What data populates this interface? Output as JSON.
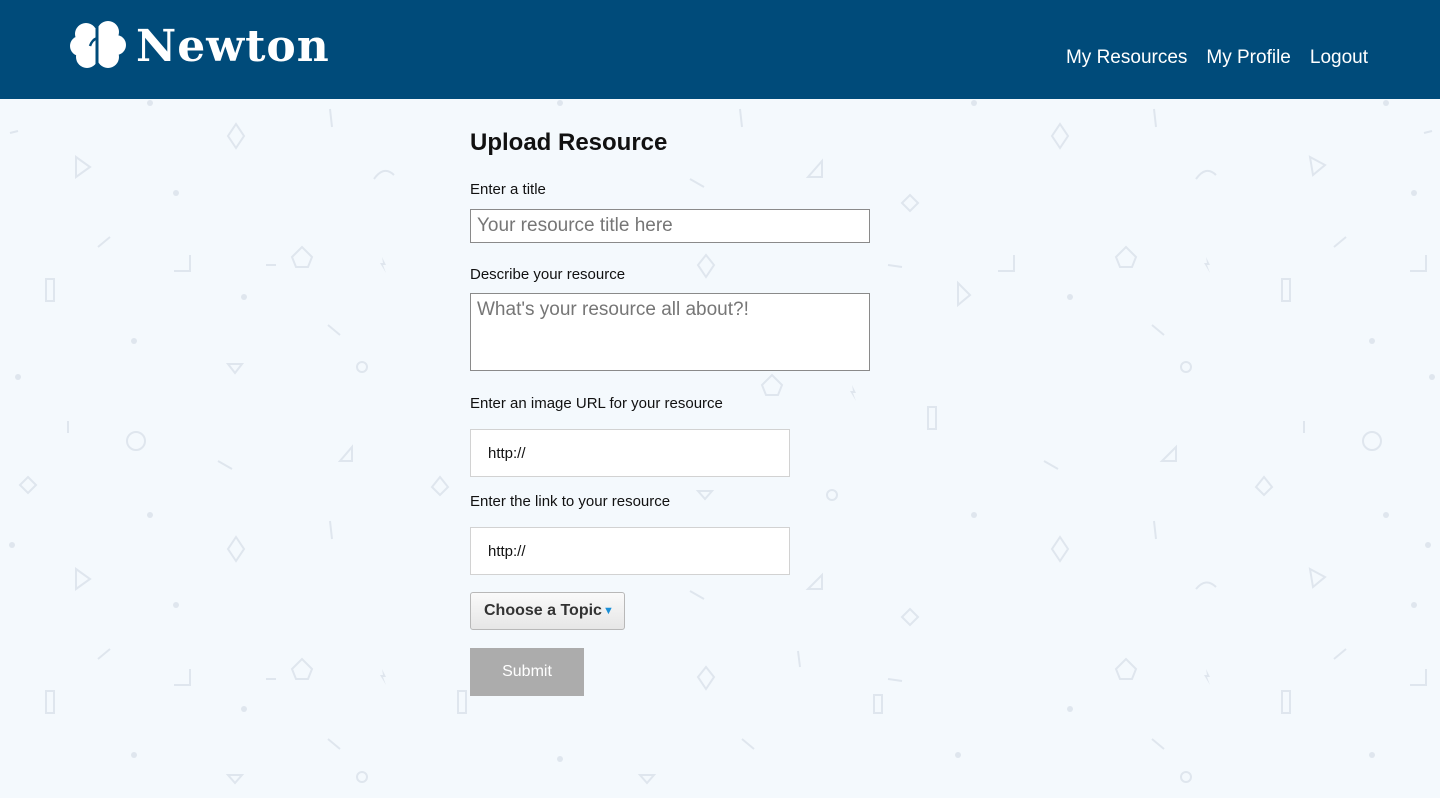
{
  "header": {
    "brand": "Newton",
    "logo_icon": "brain-icon",
    "nav": [
      "My Resources",
      "My Profile",
      "Logout"
    ]
  },
  "form": {
    "title": "Upload Resource",
    "title_label": "Enter a title",
    "title_placeholder": "Your resource title here",
    "desc_label": "Describe your resource",
    "desc_placeholder": "What's your resource all about?!",
    "image_label": "Enter an image URL for your resource",
    "image_value": "http://",
    "link_label": "Enter the link to your resource",
    "link_value": "http://",
    "topic_label": "Choose a Topic",
    "topic_caret_icon": "caret-down-icon",
    "submit_label": "Submit"
  },
  "colors": {
    "header_bg": "#004b7a",
    "page_bg": "#f4f9fd",
    "submit_bg": "#acacac",
    "caret": "#1a8fd6"
  }
}
